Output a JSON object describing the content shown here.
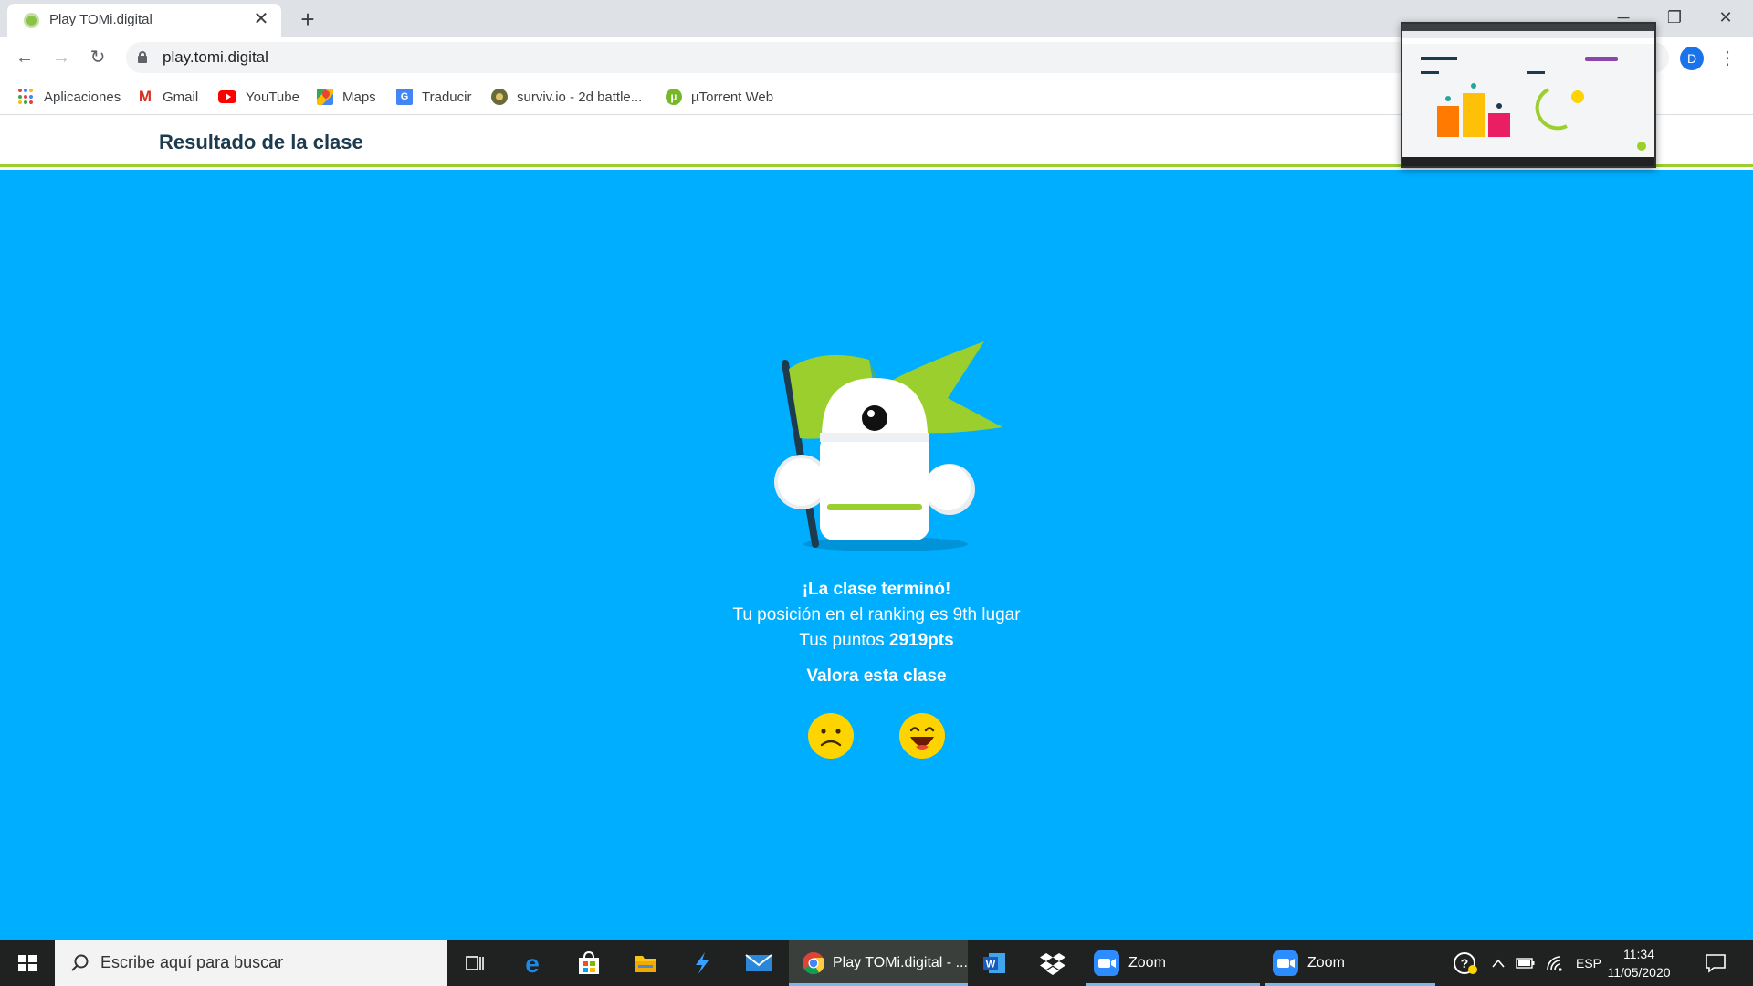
{
  "browser": {
    "tab_title": "Play TOMi.digital",
    "url": "play.tomi.digital",
    "profile_initial": "D",
    "bookmarks": [
      {
        "label": "Aplicaciones",
        "icon": "apps-grid-icon"
      },
      {
        "label": "Gmail",
        "icon": "gmail-icon"
      },
      {
        "label": "YouTube",
        "icon": "youtube-icon"
      },
      {
        "label": "Maps",
        "icon": "maps-icon"
      },
      {
        "label": "Traducir",
        "icon": "translate-icon"
      },
      {
        "label": "surviv.io - 2d battle...",
        "icon": "surviv-icon"
      },
      {
        "label": "µTorrent Web",
        "icon": "utorrent-icon"
      }
    ]
  },
  "page": {
    "header_title": "Resultado de la clase",
    "result_title": "¡La clase terminó!",
    "ranking_text": "Tu posición en el ranking es 9th lugar",
    "points_prefix": "Tus puntos ",
    "points_value": "2919pts",
    "rate_title": "Valora esta clase",
    "rating_options": [
      "sad-face",
      "happy-face"
    ]
  },
  "taskbar": {
    "search_placeholder": "Escribe aquí para buscar",
    "apps": [
      {
        "label": "Play TOMi.digital - ...",
        "icon": "chrome-icon",
        "active": true
      },
      {
        "label": "Zoom",
        "icon": "zoom-icon"
      },
      {
        "label": "Zoom",
        "icon": "zoom-icon"
      }
    ],
    "language": "ESP",
    "time": "11:34",
    "date": "11/05/2020"
  },
  "colors": {
    "page_background": "#00aeff",
    "header_accent": "#9bcf2e",
    "title_color": "#1d3b4f",
    "emoji_yellow": "#fdd400"
  }
}
